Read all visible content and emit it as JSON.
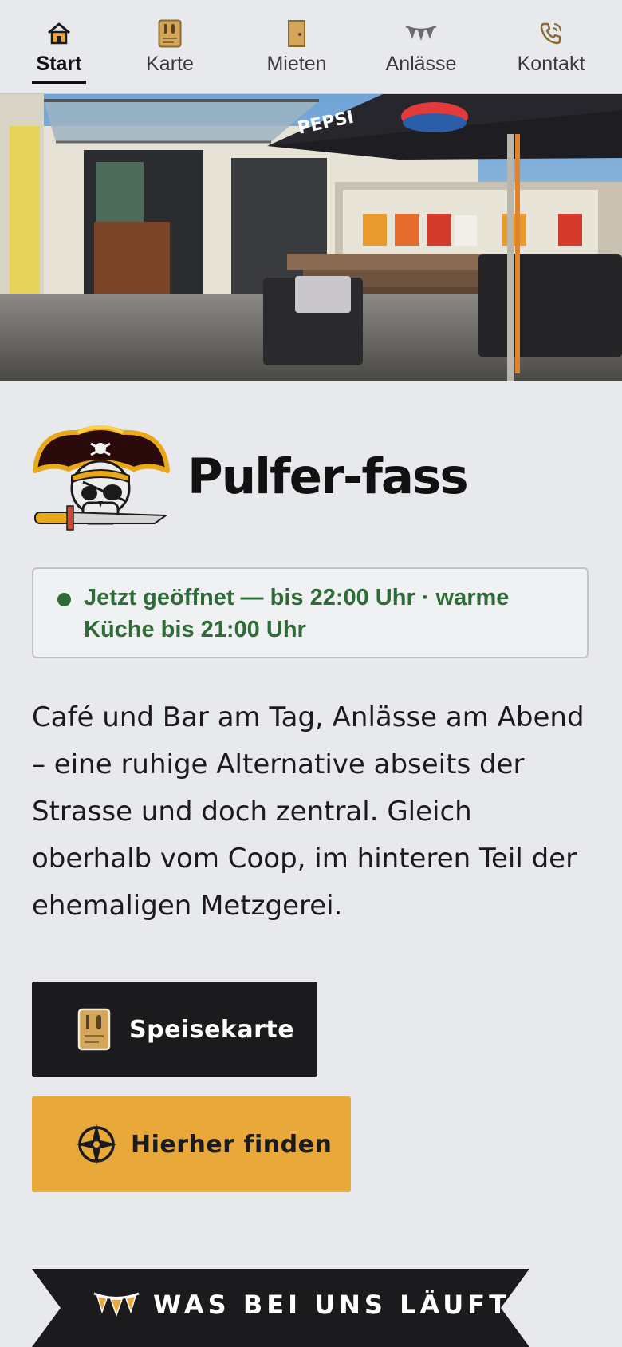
{
  "nav": {
    "items": [
      {
        "label": "Start",
        "icon": "home-icon",
        "active": true
      },
      {
        "label": "Karte",
        "icon": "menu-card-icon"
      },
      {
        "label": "Mieten",
        "icon": "door-icon"
      },
      {
        "label": "Anlässe",
        "icon": "bunting-icon"
      },
      {
        "label": "Kontakt",
        "icon": "phone-icon"
      }
    ]
  },
  "hero": {
    "image": "cafe-terrace-photo",
    "umbrella_text": "PEPSI"
  },
  "brand": {
    "logo": "pirate-skull-logo",
    "name": "Pulfer-fass"
  },
  "status": {
    "text": "Jetzt geöffnet — bis 22:00 Uhr · warme Küche bis 21:00 Uhr",
    "color": "#2f6b37"
  },
  "intro": {
    "text": "Café und Bar am Tag, Anlässe am Abend – eine ruhige Alternative abseits der Strasse und doch zentral. Gleich oberhalb vom Coop, im hinteren Teil der ehemaligen Metzgerei."
  },
  "buttons": {
    "menu_label": "Speisekarte",
    "menu_icon": "menu-card-icon",
    "find_label": "Hierher finden",
    "find_icon": "compass-icon"
  },
  "section": {
    "title": "WAS BEI UNS LÄUFT",
    "icon": "bunting-icon"
  },
  "colors": {
    "background": "#e8e9ec",
    "dark": "#1b1b1e",
    "accent": "#e9a93a",
    "icon_tan": "#d4a65a"
  }
}
